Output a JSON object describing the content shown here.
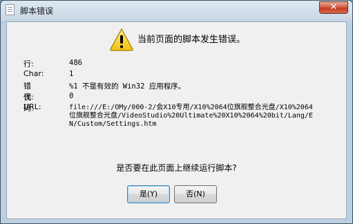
{
  "window": {
    "title": "脚本错误"
  },
  "dialog": {
    "heading": "当前页面的脚本发生错误。",
    "fields": {
      "line_label": "行:",
      "line_value": "486",
      "char_label": "Char:",
      "char_value": "1",
      "error_label": "错误:",
      "error_value": "%1 不是有效的 Win32 应用程序。",
      "code_label": "代码:",
      "code_value": "0",
      "url_label": "URL:",
      "url_value": "file:///E:/OMy/000-2/会X10专用/X10%2064位旗舰整合光盘/X10%2064位旗舰整合光盘/VideoStudio%20Ultimate%20X10%2064%20bit/Lang/EN/Custom/Settings.htm"
    },
    "question": "是否要在此页面上继续运行脚本?",
    "yes_button": "是(Y)",
    "no_button": "否(N)"
  },
  "icons": {
    "app": "document-icon",
    "warning": "warning-icon",
    "close": "close-icon"
  }
}
